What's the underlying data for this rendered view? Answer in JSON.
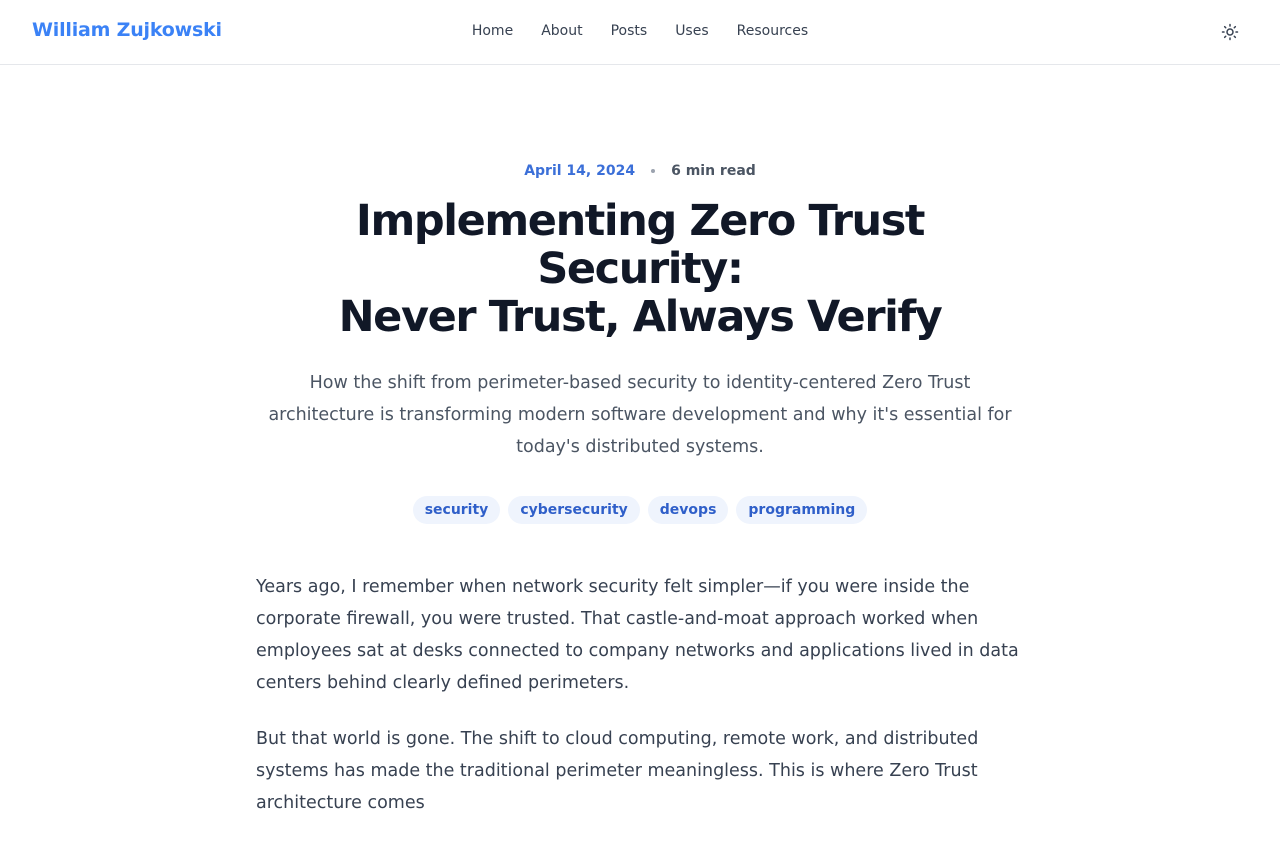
{
  "header": {
    "site_title": "William Zujkowski",
    "nav": [
      {
        "label": "Home"
      },
      {
        "label": "About"
      },
      {
        "label": "Posts"
      },
      {
        "label": "Uses"
      },
      {
        "label": "Resources"
      }
    ],
    "theme_icon": "sun-icon"
  },
  "article": {
    "date": "April 14, 2024",
    "read_time": "6 min read",
    "title_line1": "Implementing Zero Trust Security:",
    "title_line2": "Never Trust, Always Verify",
    "subtitle": "How the shift from perimeter-based security to identity-centered Zero Trust architecture is transforming modern software development and why it's essential for today's distributed systems.",
    "tags": [
      "security",
      "cybersecurity",
      "devops",
      "programming"
    ],
    "paragraphs": [
      "Years ago, I remember when network security felt simpler—if you were inside the corporate firewall, you were trusted. That castle-and-moat approach worked when employees sat at desks connected to company networks and applications lived in data centers behind clearly defined perimeters.",
      "But that world is gone. The shift to cloud computing, remote work, and distributed systems has made the traditional perimeter meaningless. This is where Zero Trust architecture comes"
    ]
  },
  "colors": {
    "accent": "#3b82f6",
    "tag_bg": "#eff4fd",
    "tag_text": "#2f5fc9",
    "heading": "#111827",
    "body_text": "#374151"
  }
}
